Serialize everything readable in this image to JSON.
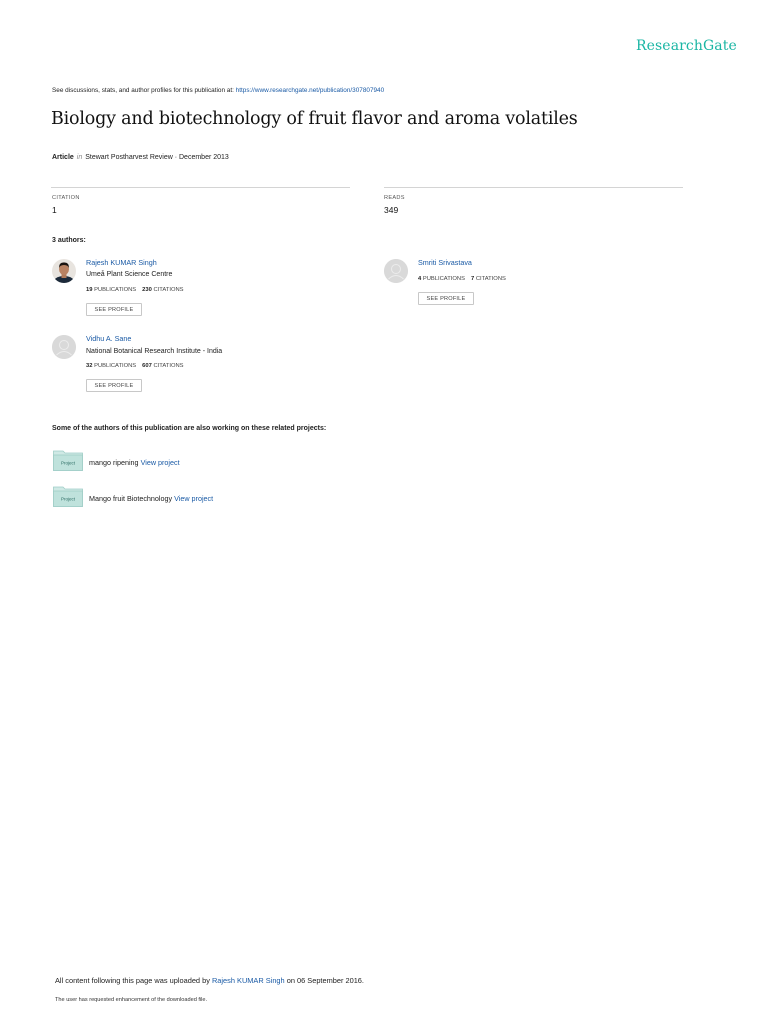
{
  "brand": {
    "logo_text": "ResearchGate",
    "accent_color": "#1bb6a4",
    "link_color": "#1a5aa5"
  },
  "header": {
    "discuss_prefix": "See discussions, stats, and author profiles for this publication at: ",
    "discuss_url": "https://www.researchgate.net/publication/307807940"
  },
  "publication": {
    "title": "Biology and biotechnology of fruit flavor and aroma volatiles",
    "type": "Article",
    "in_word": "in",
    "source": "Stewart Postharvest Review · December 2013"
  },
  "stats": {
    "citation_label": "CITATION",
    "citation_value": "1",
    "reads_label": "READS",
    "reads_value": "349"
  },
  "authors_section": {
    "heading": "3 authors:",
    "authors": [
      {
        "name": "Rajesh KUMAR Singh",
        "institution": "Umeå Plant Science Centre",
        "publications": "19",
        "publications_label": "PUBLICATIONS",
        "citations": "230",
        "citations_label": "CITATIONS",
        "button": "SEE PROFILE",
        "avatar": "photo"
      },
      {
        "name": "Smriti Srivastava",
        "institution": "",
        "publications": "4",
        "publications_label": "PUBLICATIONS",
        "citations": "7",
        "citations_label": "CITATIONS",
        "button": "SEE PROFILE",
        "avatar": "generic-user-icon"
      },
      {
        "name": "Vidhu A. Sane",
        "institution": "National Botanical Research Institute - India",
        "publications": "32",
        "publications_label": "PUBLICATIONS",
        "citations": "607",
        "citations_label": "CITATIONS",
        "button": "SEE PROFILE",
        "avatar": "generic-user-icon"
      }
    ]
  },
  "projects_section": {
    "heading": "Some of the authors of this publication are also working on these related projects:",
    "icon_label": "Project",
    "projects": [
      {
        "name": "mango ripening",
        "link": "View project"
      },
      {
        "name": "Mango fruit Biotechnology",
        "link": "View project"
      }
    ]
  },
  "footer": {
    "upload_prefix": "All content following this page was uploaded by ",
    "uploader": "Rajesh KUMAR Singh",
    "upload_suffix": " on 06 September 2016.",
    "note": "The user has requested enhancement of the downloaded file."
  }
}
